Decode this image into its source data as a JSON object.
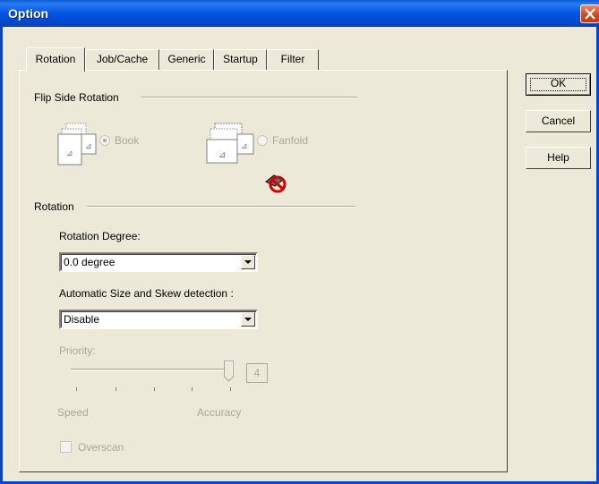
{
  "window": {
    "title": "Option"
  },
  "tabs": [
    {
      "label": "Rotation",
      "active": true
    },
    {
      "label": "Job/Cache",
      "active": false
    },
    {
      "label": "Generic",
      "active": false
    },
    {
      "label": "Startup",
      "active": false
    },
    {
      "label": "Filter",
      "active": false
    }
  ],
  "buttons": {
    "ok": "OK",
    "cancel": "Cancel",
    "help": "Help"
  },
  "flip_side": {
    "group_label": "Flip Side Rotation",
    "book_label": "Book",
    "book_selected": true,
    "fanfold_label": "Fanfold",
    "fanfold_selected": false,
    "disabled": true
  },
  "rotation": {
    "group_label": "Rotation",
    "degree_label": "Rotation Degree:",
    "degree_value": "0.0 degree",
    "skew_label": "Automatic Size and Skew detection :",
    "skew_value": "Disable",
    "priority_label": "Priority:",
    "priority_value": "4",
    "priority_level": 4,
    "priority_max": 4,
    "speed_label": "Speed",
    "accuracy_label": "Accuracy",
    "overscan_label": "Overscan",
    "overscan_checked": false
  },
  "colors": {
    "titlebar": "#0055E5",
    "dialog_bg": "#ECE9D8",
    "disabled_text": "#ACA899",
    "close_button": "#D0441E"
  },
  "icons": [
    "close-icon",
    "book-pages-icon",
    "fanfold-pages-icon",
    "not-available-icon"
  ]
}
